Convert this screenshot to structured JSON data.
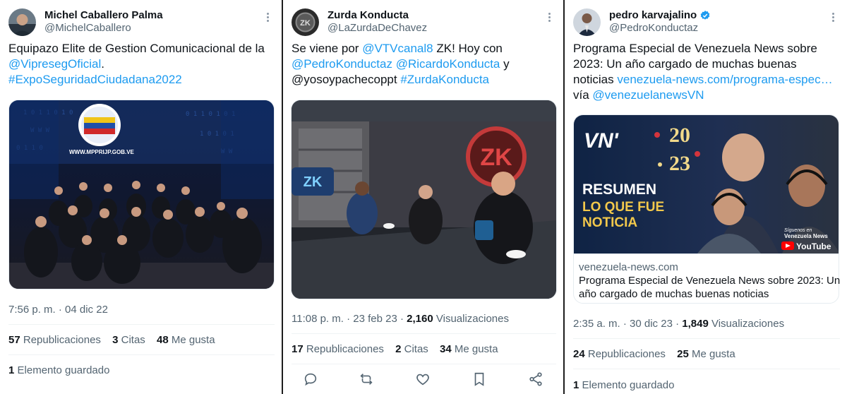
{
  "tweets": [
    {
      "name": "Michel Caballero Palma",
      "handle": "@MichelCaballero",
      "verified": false,
      "text": {
        "line1": "Equipazo Elite de Gestion Comunicacional de la",
        "mention": "@VipresegOficial",
        "period": ".",
        "hashtag": "#ExpoSeguridadCiudadana2022"
      },
      "image_banner_text": "WWW.MPPRIJP.GOB.VE",
      "timestamp": "7:56 p. m. · 04 dic 22",
      "reposts_count": "57",
      "reposts_label": "Republicaciones",
      "quotes_count": "3",
      "quotes_label": "Citas",
      "likes_count": "48",
      "likes_label": "Me gusta",
      "bookmarks_count": "1",
      "bookmarks_label": "Elemento guardado"
    },
    {
      "name": "Zurda Konducta",
      "handle": "@LaZurdaDeChavez",
      "verified": false,
      "text": {
        "l1_pre": "Se viene por",
        "l1_mention": "@VTVcanal8",
        "l1_post": "ZK! Hoy con",
        "l2_mention1": "@PedroKonductaz",
        "l2_mention2": "@RicardoKonducta",
        "l2_post": "y",
        "l3_pre": "@yosoypachecoppt",
        "l3_hashtag": "#ZurdaKonducta"
      },
      "image_logo_text": "ZK",
      "timestamp": "11:08 p. m. · 23 feb 23 · ",
      "views_count": "2,160",
      "views_label": "Visualizaciones",
      "reposts_count": "17",
      "reposts_label": "Republicaciones",
      "quotes_count": "2",
      "quotes_label": "Citas",
      "likes_count": "34",
      "likes_label": "Me gusta",
      "actions": [
        "reply-icon",
        "repost-icon",
        "like-icon",
        "bookmark-icon",
        "share-icon"
      ]
    },
    {
      "name": "pedro karvajalino",
      "handle": "@PedroKonductaz",
      "verified": true,
      "text": {
        "line1": "Programa Especial de Venezuela News sobre",
        "line2": "2023: Un año cargado de muchas buenas",
        "line3_pre": "noticias",
        "line3_link": "venezuela-news.com/programa-espec…",
        "line4_pre": "vía",
        "line4_mention": "@venezuelanewsVN"
      },
      "card": {
        "logo": "VN'",
        "year_top": "20",
        "year_bottom": "23",
        "headline1": "RESUMEN",
        "headline2": "LO QUE FUE",
        "headline3": "NOTICIA",
        "follow_text": "Síguenos en",
        "follow_brand": "Venezuela News",
        "youtube": "YouTube",
        "domain": "venezuela-news.com",
        "title_line1": "Programa Especial de Venezuela News sobre 2023: Un",
        "title_line2": "año cargado de muchas buenas noticias"
      },
      "timestamp": "2:35 a. m. · 30 dic 23 · ",
      "views_count": "1,849",
      "views_label": "Visualizaciones",
      "reposts_count": "24",
      "reposts_label": "Republicaciones",
      "likes_count": "25",
      "likes_label": "Me gusta",
      "bookmarks_count": "1",
      "bookmarks_label": "Elemento guardado"
    }
  ],
  "colors": {
    "link": "#1d9bf0",
    "text": "#0f1419",
    "secondary": "#536471",
    "divider": "#eff3f4",
    "verified": "#1d9bf0"
  }
}
